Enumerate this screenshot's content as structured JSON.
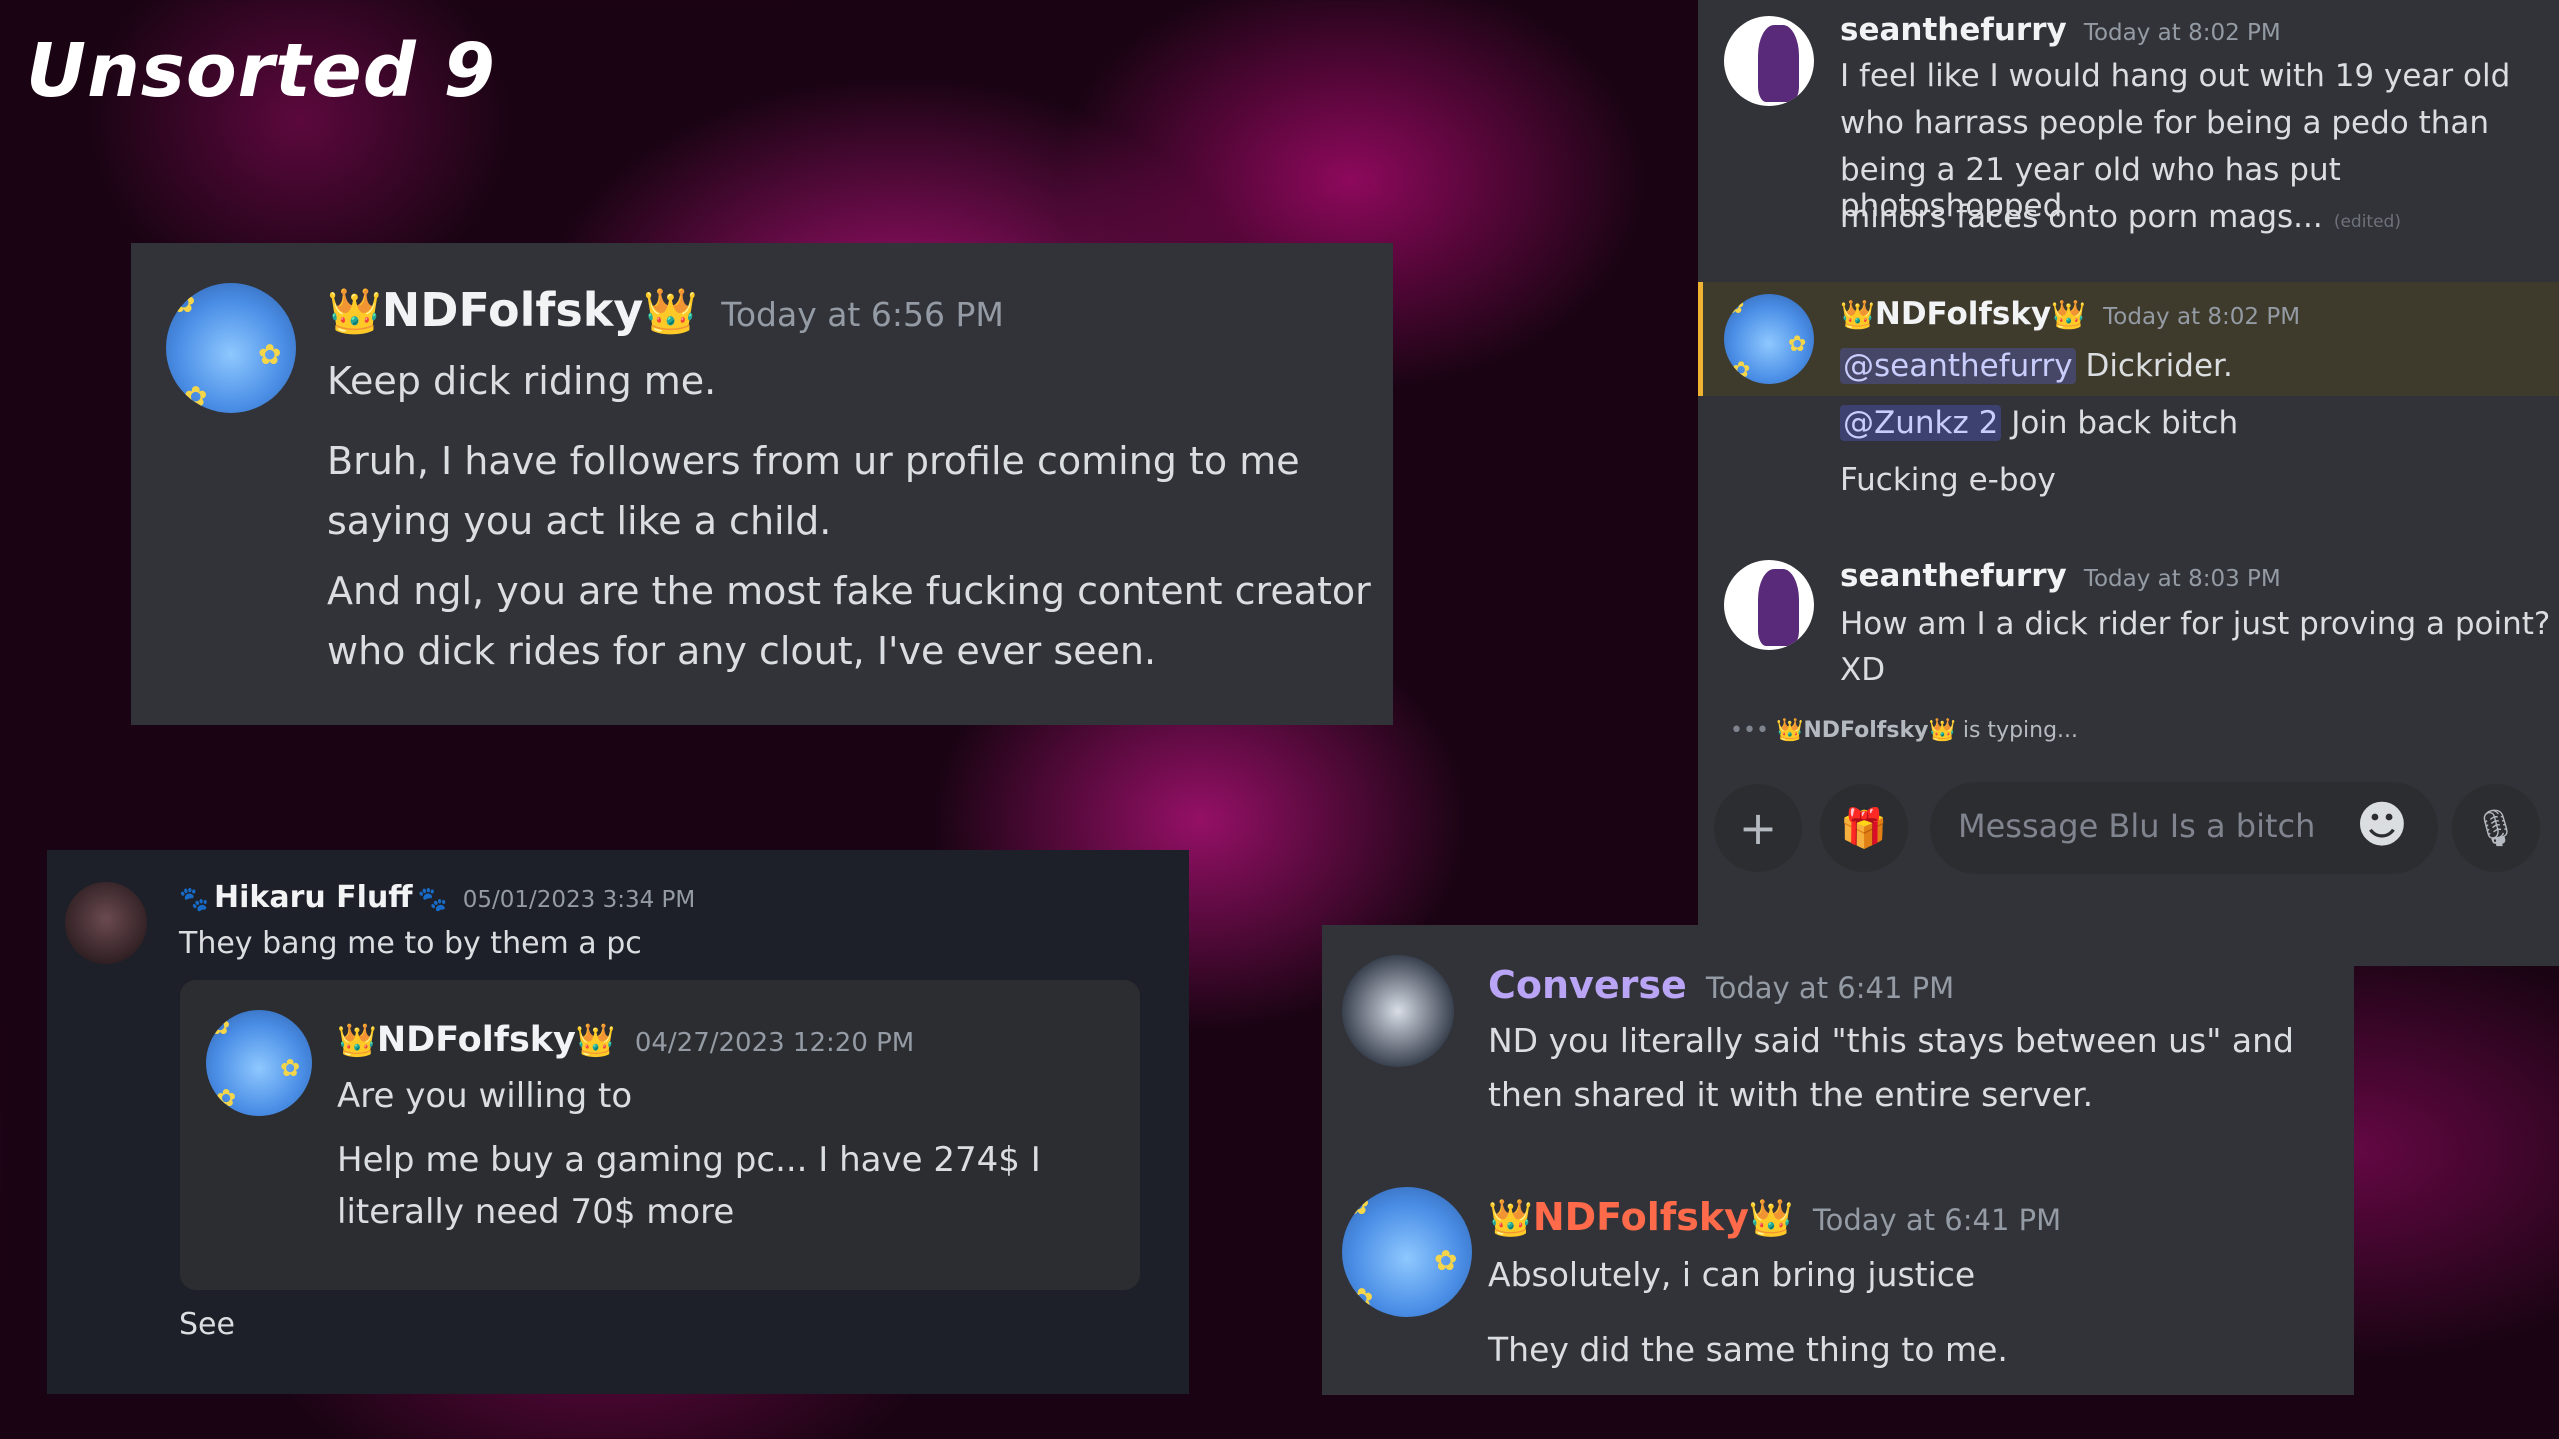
{
  "page_title": "Unsorted 9",
  "panel1": {
    "name": "NDFolfsky",
    "crown": "👑",
    "timestamp": "Today at 6:56 PM",
    "line1": "Keep dick riding me.",
    "para2a": "Bruh, I have followers from ur profile coming to me",
    "para2b": "saying you act like a child.",
    "para3a": "And ngl, you are the most fake fucking content creator",
    "para3b": "who dick rides for any clout, I've ever seen."
  },
  "panel2": {
    "msg1": {
      "name": "seanthefurry",
      "timestamp": "Today at 8:02 PM",
      "lines": [
        "I feel like I would hang out with 19 year old",
        "who harrass people for being a pedo than",
        "being a 21 year old who has put photoshopped",
        "minors faces onto porn mags..."
      ],
      "edited": "(edited)"
    },
    "msg2": {
      "name": "NDFolfsky",
      "crown": "👑",
      "timestamp": "Today at 8:02 PM",
      "mention1": "@seanthefurry",
      "text1": "Dickrider.",
      "mention2": "@Zunkz 2",
      "text2": "Join back bitch",
      "text3": "Fucking e-boy"
    },
    "msg3": {
      "name": "seanthefurry",
      "timestamp": "Today at 8:03 PM",
      "line1": "How am I a dick rider for just proving a point?",
      "line2": "XD"
    },
    "typing_dots": "•••",
    "typing_name": "NDFolfsky",
    "typing_suffix": "is typing...",
    "input_placeholder": "Message Blu Is a bitch",
    "plus_glyph": "+",
    "gift_glyph": "🎁",
    "emoji_glyph": "☻",
    "mic_glyph": "🎙"
  },
  "panel3": {
    "name": "Hikaru Fluff",
    "paw": "🐾",
    "timestamp": "05/01/2023 3:34 PM",
    "text": "They bang me to by them a pc",
    "quote": {
      "name": "NDFolfsky",
      "crown": "👑",
      "timestamp": "04/27/2023 12:20 PM",
      "line1": "Are you willing to",
      "line2a": "Help me buy a gaming pc... I have 274$ I",
      "line2b": "literally need 70$ more"
    },
    "footer": "See"
  },
  "panel4": {
    "msg1": {
      "name": "Converse",
      "timestamp": "Today at 6:41 PM",
      "line1": "ND you literally said \"this stays between us\" and",
      "line2": "then shared it with the entire server.",
      "name_color": "#b9a4f5"
    },
    "msg2": {
      "name": "NDFolfsky",
      "crown": "👑",
      "timestamp": "Today at 6:41 PM",
      "line1": "Absolutely, i can bring justice",
      "line2": "They did the same thing to me.",
      "name_color": "#ff6b4a"
    }
  },
  "colors": {
    "panel_bg": "#313338",
    "dark_panel_bg": "#1e2029",
    "highlight_bg": "#3e3a2c",
    "highlight_bar": "#f0b232",
    "mention_bg": "#3c4270"
  }
}
